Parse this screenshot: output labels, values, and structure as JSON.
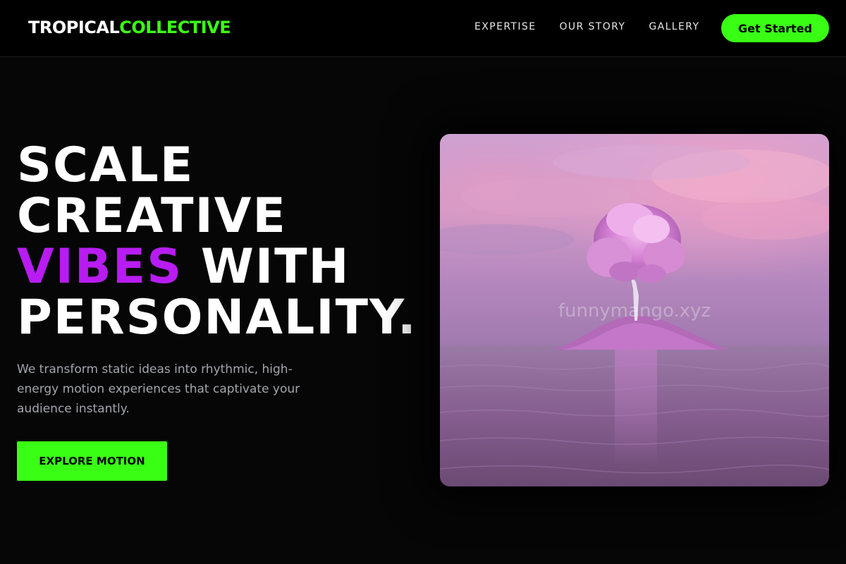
{
  "nav": {
    "logo_part1": "TROPICAL",
    "logo_part2": "COLLECTIVE",
    "links": [
      {
        "label": "EXPERTISE"
      },
      {
        "label": "OUR STORY"
      },
      {
        "label": "GALLERY"
      }
    ],
    "cta_label": "Get Started"
  },
  "hero": {
    "headline": {
      "line1": "SCALE",
      "line2": "CREATIVE",
      "line3_accent": "VIBES",
      "line3_rest": " WITH",
      "line4": "PERSONALITY."
    },
    "subtext": "We transform static ideas into rhythmic, high-energy motion experiences that captivate your audience instantly.",
    "button_label": "EXPLORE MOTION",
    "image": {
      "watermark": "funnymango.xyz",
      "icon": "tree-on-island-image"
    }
  },
  "colors": {
    "background": "#060606",
    "accent_green": "#39ff14",
    "accent_purple": "#b81cf2",
    "body_text": "#a3a6ad"
  }
}
